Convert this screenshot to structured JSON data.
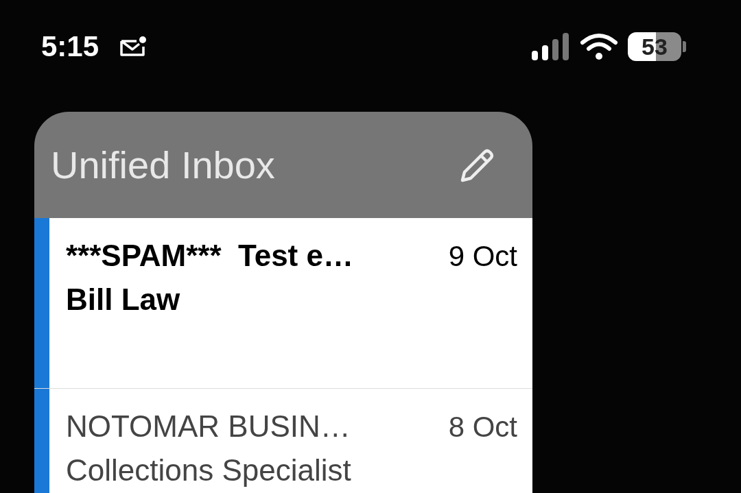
{
  "status_bar": {
    "time": "5:15",
    "battery": "53"
  },
  "widget": {
    "title": "Unified Inbox",
    "messages": [
      {
        "subject": "***SPAM***  Test e…",
        "sender": "Bill Law",
        "date": "9 Oct",
        "unread": true
      },
      {
        "subject": "NOTOMAR BUSIN…",
        "sender": "Collections Specialist",
        "date": "8 Oct",
        "unread": false
      }
    ]
  }
}
